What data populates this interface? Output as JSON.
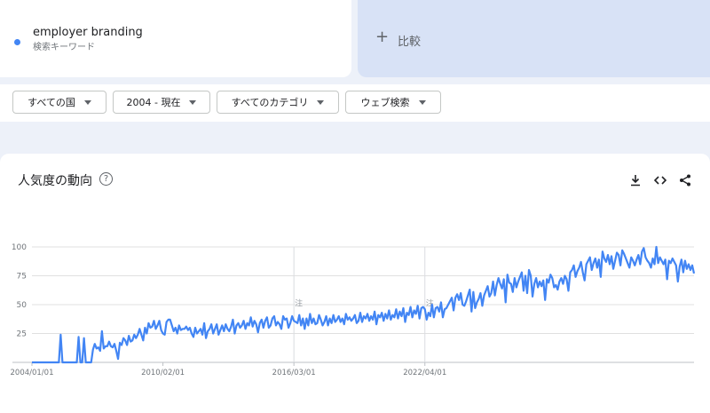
{
  "search_term": {
    "label": "employer branding",
    "sublabel": "検索キーワード",
    "color": "#4285f4"
  },
  "compare": {
    "label": "比較"
  },
  "filters": [
    {
      "label": "すべての国"
    },
    {
      "label": "2004 - 現在"
    },
    {
      "label": "すべてのカテゴリ"
    },
    {
      "label": "ウェブ検索"
    }
  ],
  "chart_card": {
    "title": "人気度の動向",
    "help_icon": "help-circle-icon",
    "tools": [
      "download-icon",
      "embed-code-icon",
      "share-icon"
    ]
  },
  "chart_data": {
    "type": "line",
    "series_color": "#4285f4",
    "ylim": [
      0,
      100
    ],
    "y_ticks": [
      "100",
      "75",
      "50",
      "25"
    ],
    "x_tick_labels": [
      "2004/01/01",
      "2010/02/01",
      "2016/03/01",
      "2022/04/01"
    ],
    "x_ticks_months": [
      0,
      73,
      146,
      219
    ],
    "annotation_marks": [
      {
        "month": 146,
        "label": "注"
      },
      {
        "month": 219,
        "label": "注"
      }
    ],
    "x_start": "2004-01",
    "values": [
      0,
      0,
      0,
      0,
      0,
      0,
      0,
      0,
      0,
      0,
      0,
      0,
      0,
      0,
      0,
      0,
      24,
      0,
      0,
      0,
      0,
      0,
      0,
      0,
      0,
      0,
      22,
      0,
      0,
      21,
      0,
      0,
      0,
      0,
      11,
      16,
      12,
      13,
      10,
      27,
      12,
      14,
      14,
      18,
      14,
      13,
      16,
      10,
      3,
      17,
      15,
      21,
      19,
      15,
      23,
      18,
      19,
      24,
      21,
      24,
      29,
      24,
      19,
      30,
      25,
      34,
      30,
      31,
      36,
      29,
      32,
      36,
      28,
      25,
      24,
      35,
      37,
      37,
      32,
      27,
      30,
      25,
      32,
      28,
      29,
      29,
      31,
      28,
      30,
      25,
      22,
      30,
      25,
      27,
      29,
      24,
      34,
      21,
      27,
      29,
      33,
      25,
      29,
      33,
      24,
      28,
      32,
      27,
      33,
      29,
      27,
      31,
      37,
      25,
      32,
      34,
      30,
      32,
      36,
      29,
      34,
      32,
      39,
      31,
      36,
      33,
      26,
      34,
      37,
      30,
      36,
      39,
      30,
      32,
      38,
      40,
      32,
      35,
      33,
      29,
      40,
      37,
      38,
      30,
      34,
      40,
      36,
      35,
      34,
      41,
      32,
      38,
      29,
      38,
      32,
      42,
      34,
      38,
      33,
      34,
      41,
      37,
      32,
      35,
      40,
      32,
      38,
      34,
      41,
      35,
      37,
      40,
      35,
      38,
      33,
      42,
      37,
      39,
      36,
      38,
      41,
      34,
      36,
      43,
      35,
      40,
      38,
      42,
      36,
      40,
      37,
      44,
      33,
      41,
      39,
      43,
      36,
      42,
      38,
      45,
      37,
      41,
      39,
      46,
      38,
      44,
      40,
      47,
      35,
      43,
      41,
      48,
      39,
      45,
      42,
      49,
      38,
      47,
      48,
      46,
      37,
      43,
      40,
      50,
      39,
      47,
      48,
      44,
      52,
      39,
      46,
      47,
      50,
      53,
      56,
      45,
      56,
      59,
      54,
      60,
      50,
      49,
      53,
      58,
      63,
      44,
      61,
      47,
      52,
      55,
      60,
      49,
      58,
      62,
      66,
      57,
      60,
      70,
      58,
      67,
      73,
      68,
      64,
      72,
      52,
      76,
      69,
      68,
      61,
      73,
      65,
      70,
      74,
      78,
      62,
      75,
      60,
      80,
      75,
      57,
      68,
      73,
      65,
      70,
      66,
      71,
      54,
      72,
      69,
      76,
      73,
      65,
      67,
      63,
      70,
      73,
      68,
      75,
      72,
      62,
      78,
      80,
      84,
      74,
      79,
      82,
      87,
      78,
      71,
      85,
      88,
      91,
      80,
      86,
      90,
      82,
      89,
      74,
      96,
      90,
      87,
      93,
      85,
      92,
      81,
      88,
      95,
      93,
      84,
      97,
      94,
      90,
      86,
      82,
      91,
      88,
      84,
      89,
      93,
      85,
      96,
      99,
      91,
      88,
      86,
      82,
      90,
      85,
      100,
      86,
      91,
      88,
      85,
      89,
      72,
      88,
      86,
      90,
      87,
      84,
      70,
      83,
      89,
      78,
      88,
      81,
      85,
      80,
      84,
      77
    ]
  }
}
